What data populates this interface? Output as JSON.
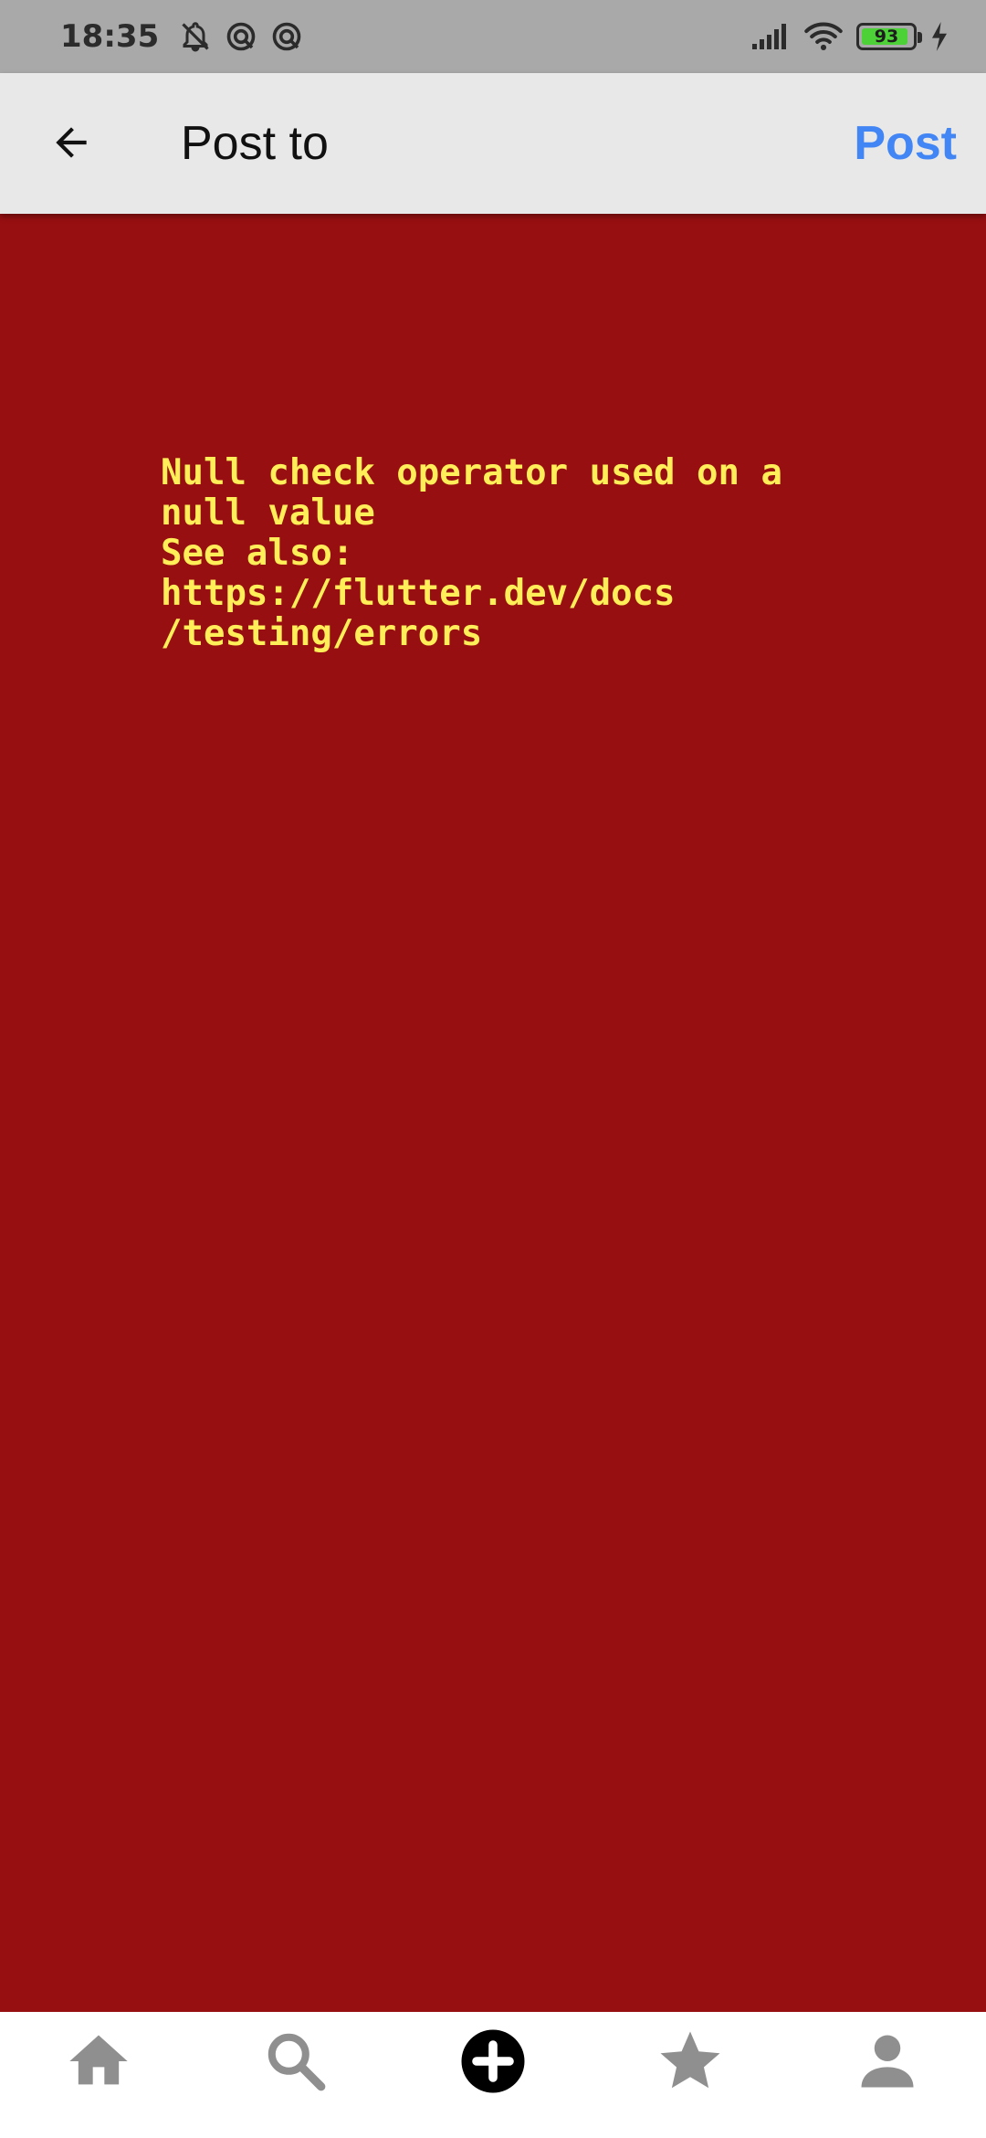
{
  "status_bar": {
    "time": "18:35",
    "battery_level": "93",
    "battery_fraction": 0.93,
    "icons": [
      "notifications-off-icon",
      "sync-icon",
      "sync-icon",
      "cellular-signal-icon",
      "wifi-icon",
      "battery-icon",
      "charging-bolt-icon"
    ]
  },
  "app_bar": {
    "title": "Post to",
    "post_label": "Post",
    "back_icon": "arrow-left-icon"
  },
  "error": {
    "message": "Null check operator used on a\nnull value\nSee also:\nhttps://flutter.dev/docs\n/testing/errors"
  },
  "bottom_nav": {
    "items": [
      "home-icon",
      "search-icon",
      "add-circle-icon",
      "star-icon",
      "profile-icon"
    ]
  },
  "colors": {
    "status_bar": "#a9a9a9",
    "app_bar": "#e8e8e8",
    "accent": "#4285f4",
    "error_background": "#970f11",
    "error_text": "#ffee58",
    "nav_icon": "#8f8f8f",
    "nav_active": "#000000",
    "battery_fill": "#4cd137"
  }
}
